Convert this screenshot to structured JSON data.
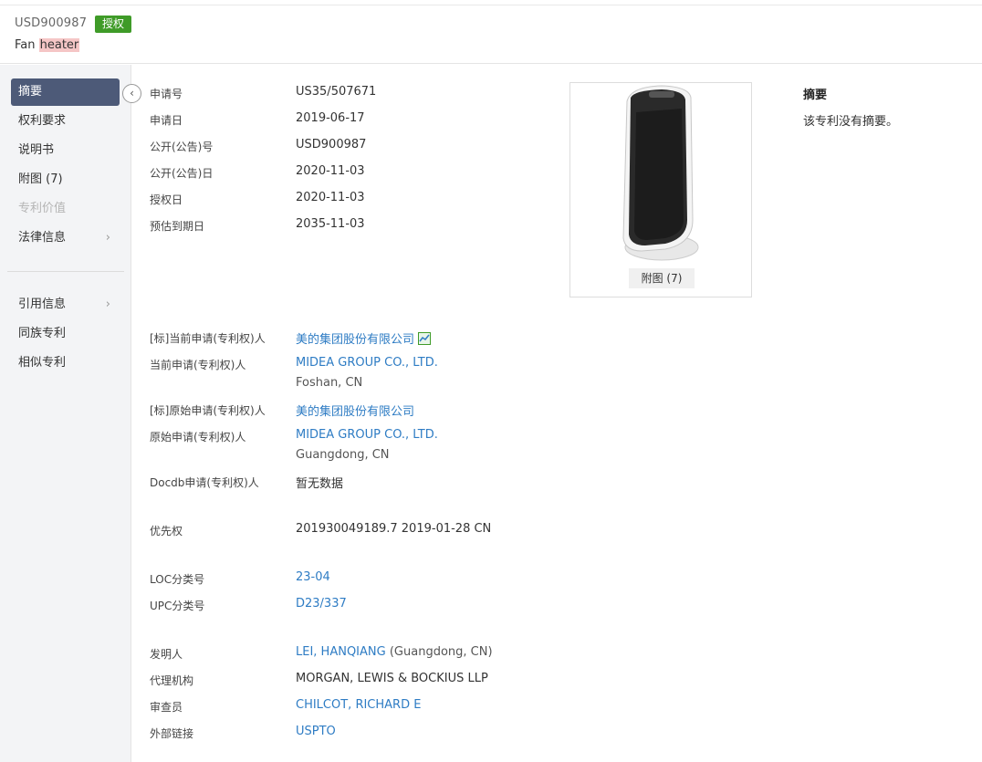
{
  "header": {
    "pub_number": "USD900987",
    "status_badge": "授权",
    "title_prefix": "Fan ",
    "title_highlight": "heater"
  },
  "sidebar": {
    "items": [
      {
        "label": "摘要",
        "active": true
      },
      {
        "label": "权利要求"
      },
      {
        "label": "说明书"
      },
      {
        "label": "附图 (7)"
      },
      {
        "label": "专利价值",
        "disabled": true
      },
      {
        "label": "法律信息",
        "chevron": "chevron-right-icon"
      },
      {
        "label": "引用信息",
        "chevron": "chevron-right-icon"
      },
      {
        "label": "同族专利"
      },
      {
        "label": "相似专利"
      }
    ],
    "collapse_icon": "chevron-left-icon"
  },
  "basic": {
    "app_no_label": "申请号",
    "app_no": "US35/507671",
    "app_date_label": "申请日",
    "app_date": "2019-06-17",
    "pub_no_label": "公开(公告)号",
    "pub_no": "USD900987",
    "pub_date_label": "公开(公告)日",
    "pub_date": "2020-11-03",
    "grant_date_label": "授权日",
    "grant_date": "2020-11-03",
    "expiry_label": "预估到期日",
    "expiry": "2035-11-03"
  },
  "figure": {
    "caption": "附图 (7)"
  },
  "abstract": {
    "title": "摘要",
    "text": "该专利没有摘要。"
  },
  "parties": {
    "std_current_label": "[标]当前申请(专利权)人",
    "std_current": "美的集团股份有限公司",
    "current_label": "当前申请(专利权)人",
    "current": "MIDEA GROUP CO., LTD.",
    "current_loc": "Foshan, CN",
    "std_original_label": "[标]原始申请(专利权)人",
    "std_original": "美的集团股份有限公司",
    "original_label": "原始申请(专利权)人",
    "original": "MIDEA GROUP CO., LTD.",
    "original_loc": "Guangdong, CN",
    "docdb_label": "Docdb申请(专利权)人",
    "docdb": "暂无数据"
  },
  "priority": {
    "label": "优先权",
    "value": "201930049189.7 2019-01-28 CN"
  },
  "classes": {
    "loc_label": "LOC分类号",
    "loc": "23-04",
    "upc_label": "UPC分类号",
    "upc": "D23/337"
  },
  "people": {
    "inventor_label": "发明人",
    "inventor": "LEI, HANQIANG",
    "inventor_loc": " (Guangdong, CN)",
    "agency_label": "代理机构",
    "agency": "MORGAN, LEWIS & BOCKIUS LLP",
    "examiner_label": "审查员",
    "examiner": "CHILCOT, RICHARD E",
    "link_label": "外部链接",
    "link": "USPTO"
  },
  "colors": {
    "accent": "#2e7cc4",
    "badge": "#3f9b28",
    "nav_active": "#4d5a78"
  }
}
